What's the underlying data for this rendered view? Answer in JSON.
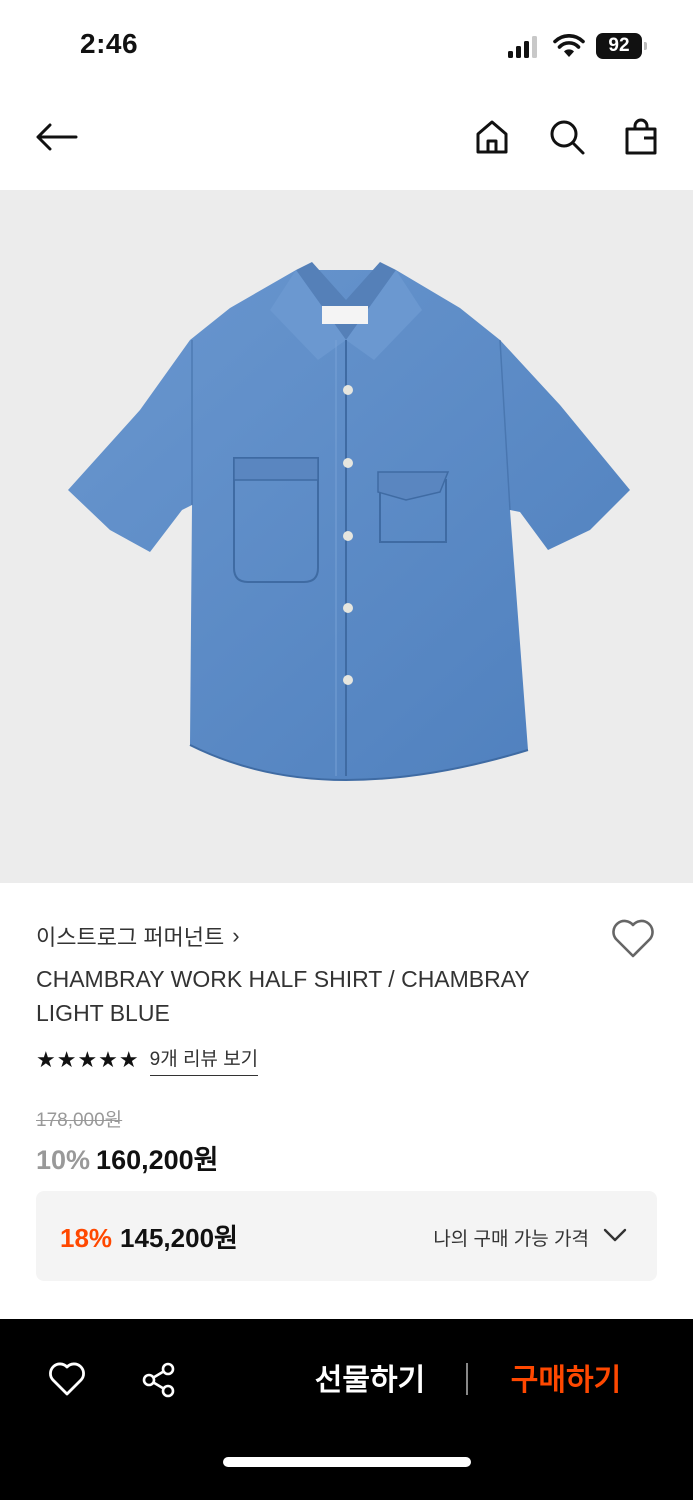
{
  "status_bar": {
    "time": "2:46",
    "battery": "92"
  },
  "nav": {
    "back_icon": "arrow-left-icon",
    "home_icon": "home-icon",
    "search_icon": "search-icon",
    "bag_icon": "shopping-bag-icon"
  },
  "product": {
    "image_alt_icon": "shirt-image",
    "brand": "이스트로그 퍼머넌트",
    "brand_chevron": "›",
    "title": "CHAMBRAY WORK HALF SHIRT / CHAMBRAY LIGHT BLUE",
    "stars": "★★★★★",
    "rating": 5,
    "review_link": "9개 리뷰 보기",
    "original_price": "178,000원",
    "discount": "10%",
    "sale_price": "160,200원"
  },
  "my_price": {
    "discount": "18%",
    "price": "145,200원",
    "label": "나의 구매 가능 가격"
  },
  "bottom_bar": {
    "gift_label": "선물하기",
    "buy_label": "구매하기",
    "heart_icon": "heart-outline-icon",
    "share_icon": "share-icon"
  },
  "colors": {
    "accent": "#ff4800",
    "image_bg": "#ececec",
    "shirt": "#5b89c2"
  }
}
